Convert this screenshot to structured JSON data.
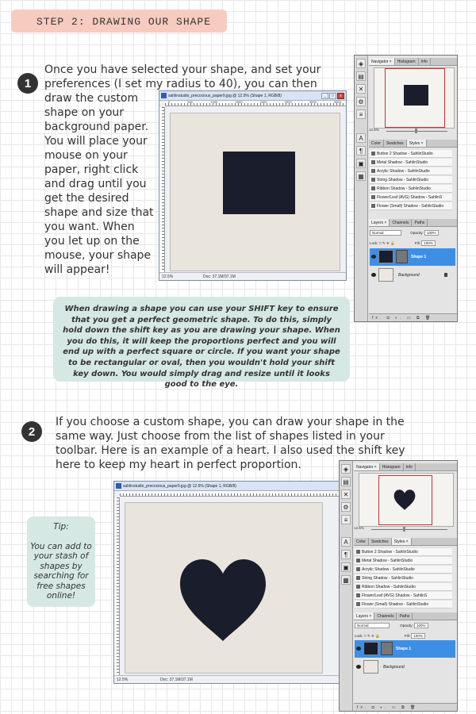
{
  "header": {
    "step_label": "STEP 2: DRAWING OUR SHAPE"
  },
  "step1": {
    "number": "1",
    "text_line1": "Once you have selected your shape, and set your",
    "text_line2": "preferences (I set my radius to 40), you can then",
    "text_col": [
      "draw the custom",
      "shape on your",
      "background paper.",
      "You will place your",
      "mouse on your",
      "paper, right click",
      "and drag until you",
      "get the desired",
      "shape and size that",
      "you want. When",
      "you let up on the",
      "mouse, your shape",
      "will appear!"
    ]
  },
  "note": {
    "text": "When drawing a shape you can use your SHIFT key to ensure that you get a perfect geometric shape. To do this, simply hold down the shift key as you are drawing your shape. When you do this, it will keep the proportions perfect and you will end up with a perfect square or circle. If you want your shape to be rectangular or oval, then you wouldn't hold your shift key down. You would simply drag and resize until it looks good to the eye."
  },
  "step2": {
    "number": "2",
    "text_lines": [
      "If you choose a custom shape, you can draw your shape in the",
      "same way. Just choose from the list of shapes listed in your",
      "toolbar. Here is an example of a heart. I also used the shift key",
      "here to keep my heart in perfect proportion."
    ]
  },
  "tip": {
    "title": "Tip:",
    "text": "You can add to your stash of shapes by searching for free shapes online!"
  },
  "doc_window": {
    "title": "sahlinstudio_precocious_paper9.jpg @ 12.5% (Shape 1, RGB/8)",
    "zoom": "12.5%",
    "doc_info": "Doc: 37.1M/37.1M",
    "ruler_marks": [
      "0",
      "500",
      "1000",
      "1500",
      "2000",
      "2500",
      "3000",
      "3500"
    ],
    "btn_min": "_",
    "btn_max": "□",
    "btn_close": "x"
  },
  "panel": {
    "nav_tabs": [
      "Navigator ×",
      "Histogram",
      "Info"
    ],
    "zoom": "12.5%",
    "style_tabs": [
      "Color",
      "Swatches",
      "Styles ×"
    ],
    "styles": [
      "Button 2 Shadow - SahlinStudio",
      "Metal Shadow - SahlinStudio",
      "Acrylic Shadow - SahlinStudio",
      "String Shadow - SahlinStudio",
      "Ribbon Shadow - SahlinStudio",
      "Flower/Leaf (AVG) Shadow - SahlinS",
      "Flower (Small) Shadow - SahlinStudio"
    ],
    "layer_tabs": [
      "Layers ×",
      "Channels",
      "Paths"
    ],
    "blend_mode": "Normal",
    "opacity_label": "Opacity:",
    "opacity": "100%",
    "lock_label": "Lock:",
    "fill_label": "Fill:",
    "fill": "100%",
    "layers": [
      "Shape 1",
      "Background"
    ],
    "bottom_icons": "fx. ◘ ◐. ▭ ⧉ 🗑"
  },
  "colors": {
    "shape": "#1a1d2b",
    "paper": "#e9e5dd",
    "accent_tab": "#f8cbc0",
    "note_bg": "#d6e8e3",
    "selected_layer": "#3d8fe6"
  }
}
